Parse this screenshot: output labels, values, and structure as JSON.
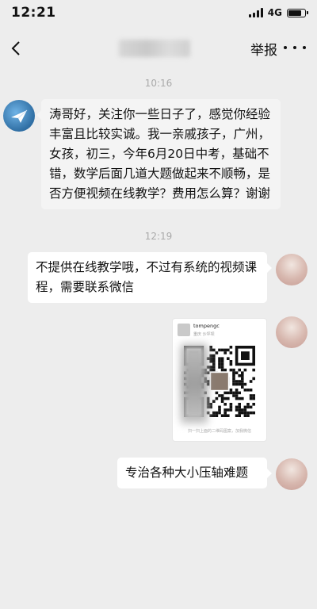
{
  "status_bar": {
    "time": "12:21",
    "network": "4G",
    "battery_level": 0.85
  },
  "nav": {
    "report_label": "举报"
  },
  "messages": [
    {
      "time": "10:16",
      "side": "left",
      "text": "涛哥好，关注你一些日子了，感觉你经验丰富且比较实诚。我一亲戚孩子，广州，女孩，初三，今年6月20日中考，基础不错，数学后面几道大题做起来不顺畅，是否方便视频在线教学？费用怎么算？谢谢"
    },
    {
      "time": "12:19",
      "side": "right",
      "text": "不提供在线教学哦，不过有系统的视频课程，需要联系微信"
    },
    {
      "side": "right",
      "type": "image",
      "card_name": "tompengc",
      "card_region": "重庆 沙坪坝",
      "card_footer": "扫一扫上面的二维码图案，加我微信"
    },
    {
      "side": "right",
      "text": "专治各种大小压轴难题"
    }
  ]
}
